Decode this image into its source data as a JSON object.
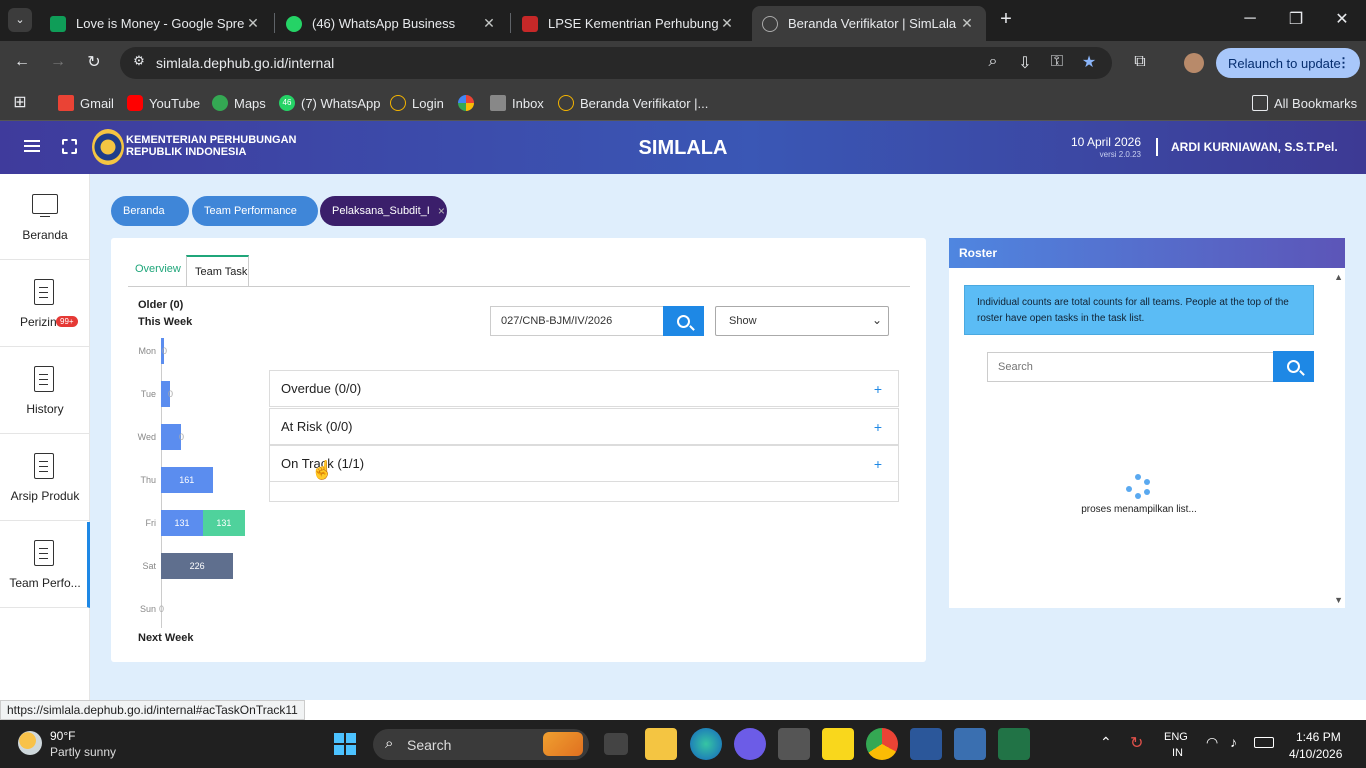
{
  "browser": {
    "tabs": [
      {
        "title": "Love is Money - Google Spread",
        "active": false
      },
      {
        "title": "(46) WhatsApp Business",
        "active": false
      },
      {
        "title": "LPSE Kementrian Perhubungan",
        "active": false
      },
      {
        "title": "Beranda Verifikator | SimLala",
        "active": true
      }
    ],
    "url": "simlala.dephub.go.id/internal",
    "relaunch_label": "Relaunch to update",
    "bookmarks": [
      "Gmail",
      "YouTube",
      "Maps",
      "(7) WhatsApp",
      "Login",
      "Inbox",
      "Beranda Verifikator |..."
    ],
    "whatsapp_badge": "46",
    "all_bookmarks_label": "All Bookmarks",
    "status_url": "https://simlala.dephub.go.id/internal#acTaskOnTrack11"
  },
  "header": {
    "org_line1": "KEMENTERIAN PERHUBUNGAN",
    "org_line2": "REPUBLIK INDONESIA",
    "app_title": "SIMLALA",
    "date": "10 April 2026",
    "version": "versi 2.0.23",
    "user": "ARDI KURNIAWAN, S.S.T.Pel."
  },
  "sidebar": {
    "items": [
      {
        "label": "Beranda"
      },
      {
        "label": "Perizinan",
        "badge": "99+"
      },
      {
        "label": "History"
      },
      {
        "label": "Arsip Produk"
      },
      {
        "label": "Team Perfo..."
      }
    ]
  },
  "breadcrumb": {
    "items": [
      "Beranda",
      "Team Performance",
      "Pelaksana_Subdit_I"
    ],
    "close_glyph": "×"
  },
  "main": {
    "tabs": [
      "Overview",
      "Team Task"
    ],
    "older_label": "Older (0)",
    "this_week_label": "This Week",
    "next_week_label": "Next Week",
    "search_value": "027/CNB-BJM/IV/2026",
    "show_select": "Show",
    "accordions": [
      {
        "label": "Overdue (0/0)"
      },
      {
        "label": "At Risk (0/0)"
      },
      {
        "label": "On Track (1/1)"
      }
    ],
    "plus_glyph": "+"
  },
  "chart_data": {
    "type": "bar",
    "orientation": "horizontal",
    "categories": [
      "Mon",
      "Tue",
      "Wed",
      "Thu",
      "Fri",
      "Sat",
      "Sun"
    ],
    "series": [
      {
        "color": "#5b8def",
        "values": [
          0,
          0,
          0,
          161,
          131,
          0,
          0
        ]
      },
      {
        "color": "#4fd29c",
        "values": [
          0,
          0,
          0,
          0,
          131,
          0,
          0
        ]
      },
      {
        "color": "#5f6f8e",
        "values": [
          0,
          0,
          0,
          0,
          0,
          226,
          0
        ]
      }
    ],
    "data_labels": {
      "Mon": "0",
      "Tue": "0",
      "Wed": "0",
      "Thu": "161",
      "Fri": "131",
      "Fri_2": "131",
      "Sat": "226",
      "Sun": "0"
    }
  },
  "roster": {
    "title": "Roster",
    "info": "Individual counts are total counts for all teams. People at the top of the roster have open tasks in the task list.",
    "search_placeholder": "Search",
    "loading_text": "proses menampilkan list..."
  },
  "taskbar": {
    "weather_temp": "90°F",
    "weather_desc": "Partly sunny",
    "search_label": "Search",
    "lang1": "ENG",
    "lang2": "IN",
    "time": "1:46 PM",
    "date": "4/10/2026"
  },
  "colors": {
    "header_gradient_start": "#3f3b9c",
    "crumb_blue": "#3f86d8",
    "crumb_active": "#3b1f6b",
    "accent_green": "#1fa67a",
    "search_blue": "#1e88e5",
    "info_box": "#5bbcf5"
  }
}
